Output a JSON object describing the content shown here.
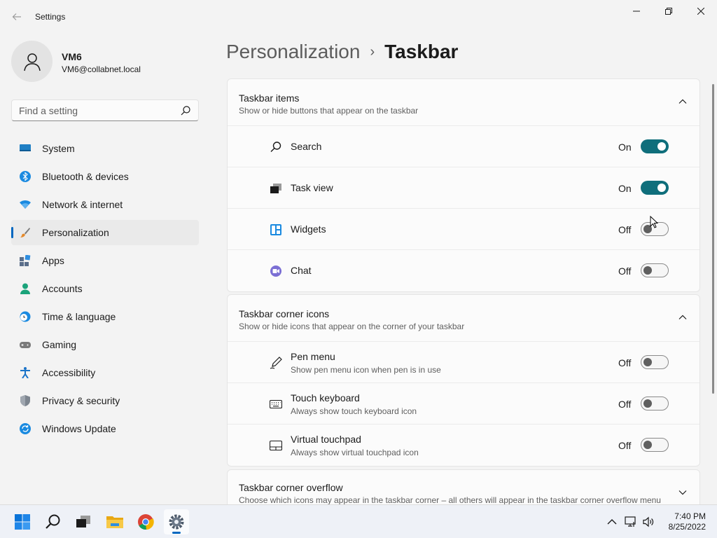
{
  "window": {
    "app_title": "Settings",
    "back_icon": "arrow-left-icon",
    "controls": [
      "minimize-icon",
      "maximize-icon",
      "close-icon"
    ]
  },
  "profile": {
    "name": "VM6",
    "email": "VM6@collabnet.local"
  },
  "search": {
    "placeholder": "Find a setting",
    "value": ""
  },
  "sidebar": {
    "items": [
      {
        "label": "System",
        "icon": "monitor-icon",
        "active": false
      },
      {
        "label": "Bluetooth & devices",
        "icon": "bluetooth-icon",
        "active": false
      },
      {
        "label": "Network & internet",
        "icon": "wifi-icon",
        "active": false
      },
      {
        "label": "Personalization",
        "icon": "brush-icon",
        "active": true
      },
      {
        "label": "Apps",
        "icon": "apps-icon",
        "active": false
      },
      {
        "label": "Accounts",
        "icon": "person-icon",
        "active": false
      },
      {
        "label": "Time & language",
        "icon": "globe-clock-icon",
        "active": false
      },
      {
        "label": "Gaming",
        "icon": "gamepad-icon",
        "active": false
      },
      {
        "label": "Accessibility",
        "icon": "accessibility-icon",
        "active": false
      },
      {
        "label": "Privacy & security",
        "icon": "shield-icon",
        "active": false
      },
      {
        "label": "Windows Update",
        "icon": "update-icon",
        "active": false
      }
    ]
  },
  "breadcrumb": {
    "parent": "Personalization",
    "separator": "›",
    "current": "Taskbar"
  },
  "sections": [
    {
      "title": "Taskbar items",
      "subtitle": "Show or hide buttons that appear on the taskbar",
      "expanded": true,
      "rows": [
        {
          "label": "Search",
          "icon": "search-icon",
          "state": "On",
          "on": true
        },
        {
          "label": "Task view",
          "icon": "task-view-icon",
          "state": "On",
          "on": true
        },
        {
          "label": "Widgets",
          "icon": "widgets-icon",
          "state": "Off",
          "on": false
        },
        {
          "label": "Chat",
          "icon": "chat-icon",
          "state": "Off",
          "on": false
        }
      ]
    },
    {
      "title": "Taskbar corner icons",
      "subtitle": "Show or hide icons that appear on the corner of your taskbar",
      "expanded": true,
      "rows": [
        {
          "label": "Pen menu",
          "sub": "Show pen menu icon when pen is in use",
          "icon": "pen-icon",
          "state": "Off",
          "on": false
        },
        {
          "label": "Touch keyboard",
          "sub": "Always show touch keyboard icon",
          "icon": "keyboard-icon",
          "state": "Off",
          "on": false
        },
        {
          "label": "Virtual touchpad",
          "sub": "Always show virtual touchpad icon",
          "icon": "touchpad-icon",
          "state": "Off",
          "on": false
        }
      ]
    },
    {
      "title": "Taskbar corner overflow",
      "subtitle": "Choose which icons may appear in the taskbar corner – all others will appear in the taskbar corner overflow menu",
      "expanded": false
    }
  ],
  "taskbar": {
    "apps": [
      "windows-start-icon",
      "search-icon",
      "task-view-icon",
      "file-explorer-icon",
      "chrome-icon",
      "settings-gear-icon"
    ],
    "tray": [
      "chevron-up-icon",
      "network-icon",
      "volume-icon"
    ],
    "time": "7:40 PM",
    "date": "8/25/2022"
  },
  "colors": {
    "accent": "#0067c0",
    "toggle_on": "#0f6e7b",
    "background": "#f3f3f3",
    "card": "#fbfbfb"
  }
}
